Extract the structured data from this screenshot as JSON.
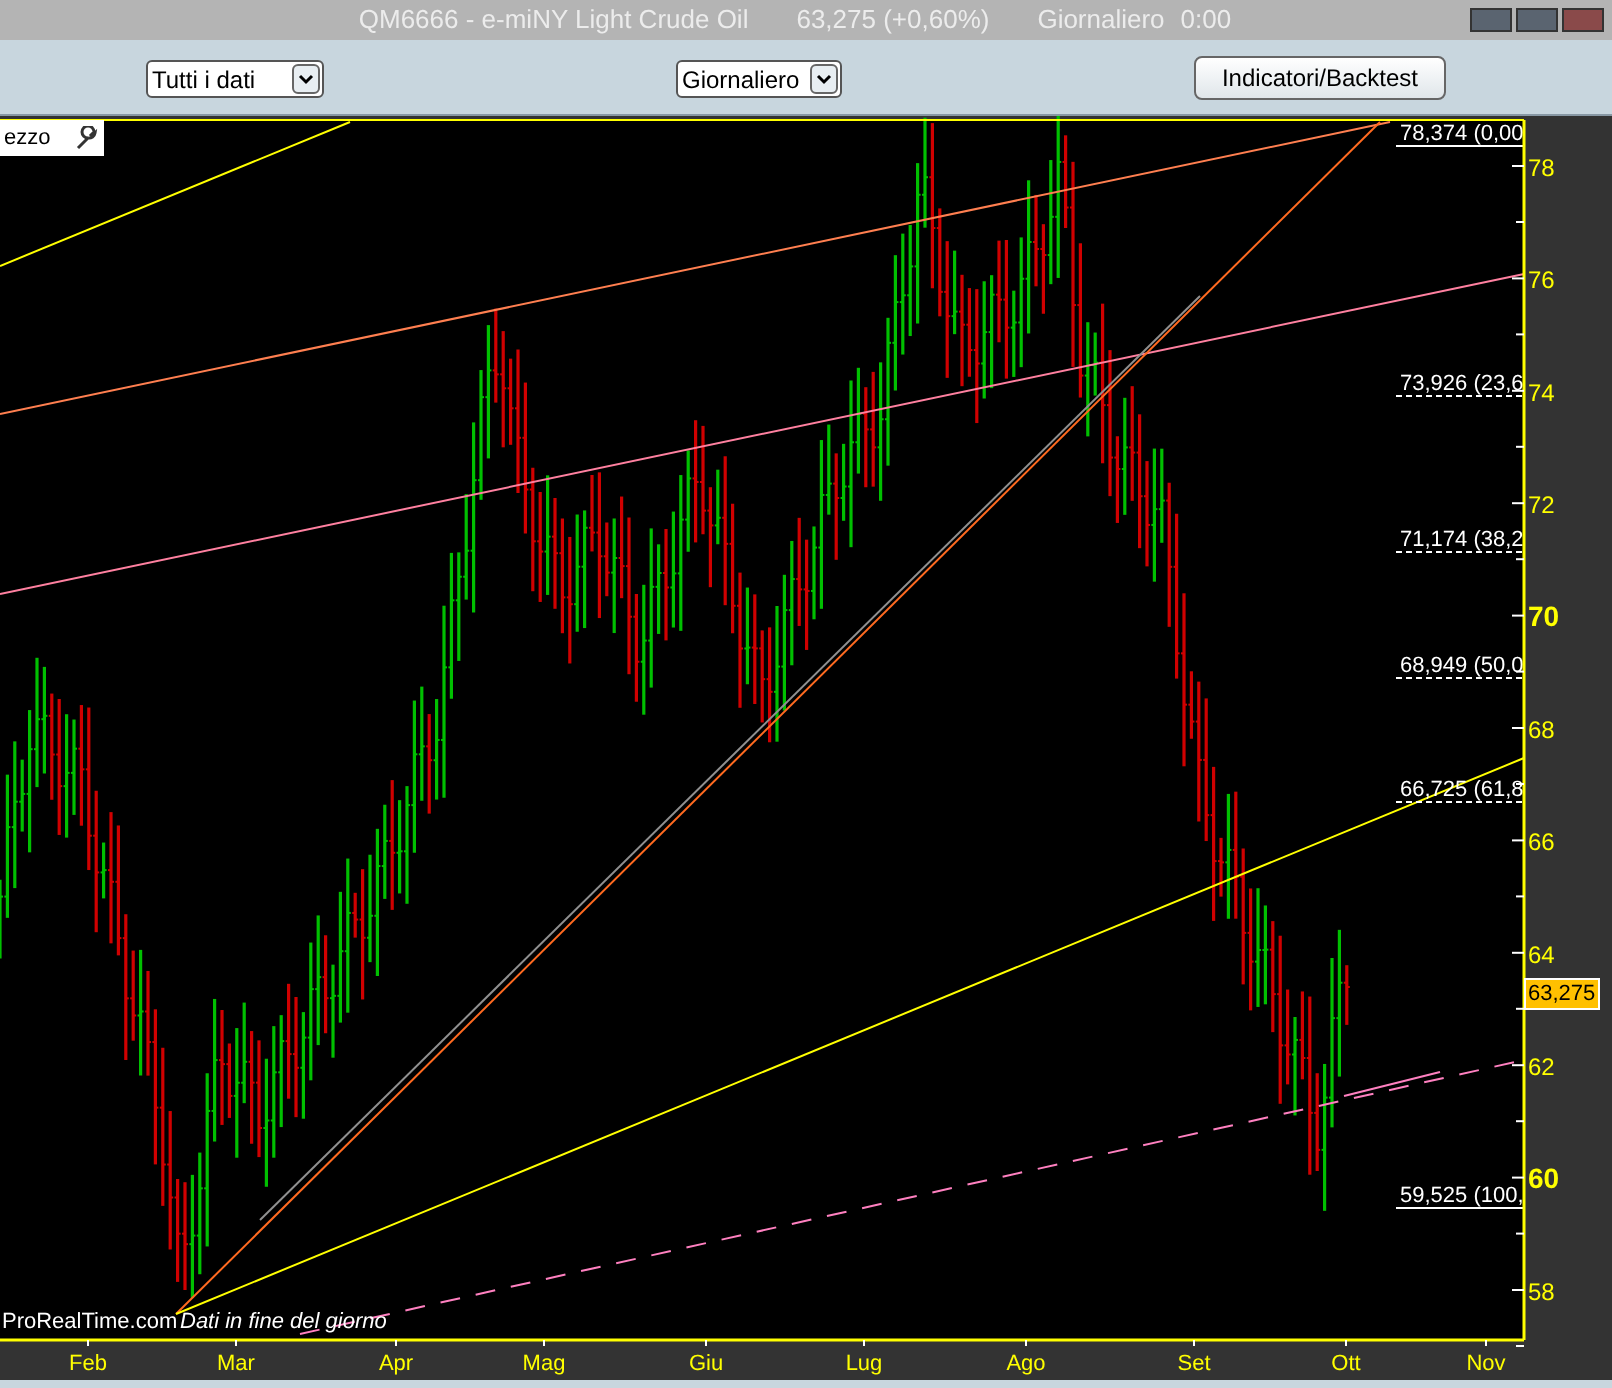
{
  "window": {
    "title": "QM6666 - e-miNY Light Crude Oil",
    "quote": "63,275 (+0,60%)",
    "period": "Giornaliero",
    "time": "0:00"
  },
  "toolbar": {
    "range_select": {
      "value": "Tutti i dati"
    },
    "period_select": {
      "value": "Giornaliero"
    },
    "indicators_button": {
      "label": "Indicatori/Backtest"
    }
  },
  "chart": {
    "panel_label": "ezzo",
    "y_axis": [
      {
        "label": "78",
        "bold": false
      },
      {
        "label": "76",
        "bold": false
      },
      {
        "label": "74",
        "bold": false
      },
      {
        "label": "72",
        "bold": false
      },
      {
        "label": "70",
        "bold": true
      },
      {
        "label": "68",
        "bold": false
      },
      {
        "label": "66",
        "bold": false
      },
      {
        "label": "64",
        "bold": false
      },
      {
        "label": "62",
        "bold": false
      },
      {
        "label": "60",
        "bold": true
      },
      {
        "label": "58",
        "bold": false
      }
    ],
    "x_axis": [
      "Feb",
      "Mar",
      "Apr",
      "Mag",
      "Giu",
      "Lug",
      "Ago",
      "Set",
      "Ott",
      "Nov"
    ],
    "fibonacci_levels": [
      "78,374 (0,00",
      "73,926 (23,6",
      "71,174 (38,2",
      "68,949 (50,0",
      "66,725 (61,8",
      "59,525 (100,"
    ],
    "last_price": "63,275",
    "source": "ProRealTime.com",
    "note": "Dati in fine del giorno"
  }
}
